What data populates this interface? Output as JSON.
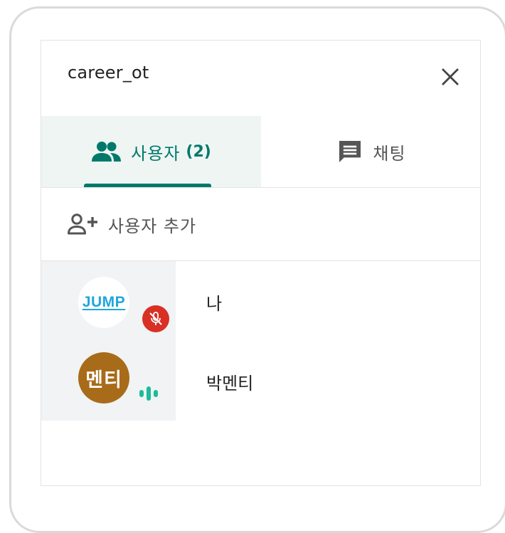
{
  "meeting": {
    "title": "career_ot"
  },
  "tabs": [
    {
      "label": "사용자",
      "count": "(2)",
      "icon": "people-icon",
      "active": true
    },
    {
      "label": "채팅",
      "icon": "chat-icon",
      "active": false
    }
  ],
  "add_people": {
    "label": "사용자 추가",
    "icon": "person-add-icon"
  },
  "participants": [
    {
      "name": "나",
      "avatar_text": "JUMP",
      "status": "muted",
      "status_icon": "mic-off-icon"
    },
    {
      "name": "박멘티",
      "avatar_text": "멘티",
      "status": "speaking",
      "status_icon": "audio-level-icon"
    }
  ],
  "colors": {
    "accent": "#00796b",
    "active_tab_bg": "#eef5f3",
    "muted_badge": "#d93025",
    "speaking": "#1bbc9b",
    "mentee_avatar": "#a86b1a",
    "jump_logo": "#1fa6dd"
  }
}
